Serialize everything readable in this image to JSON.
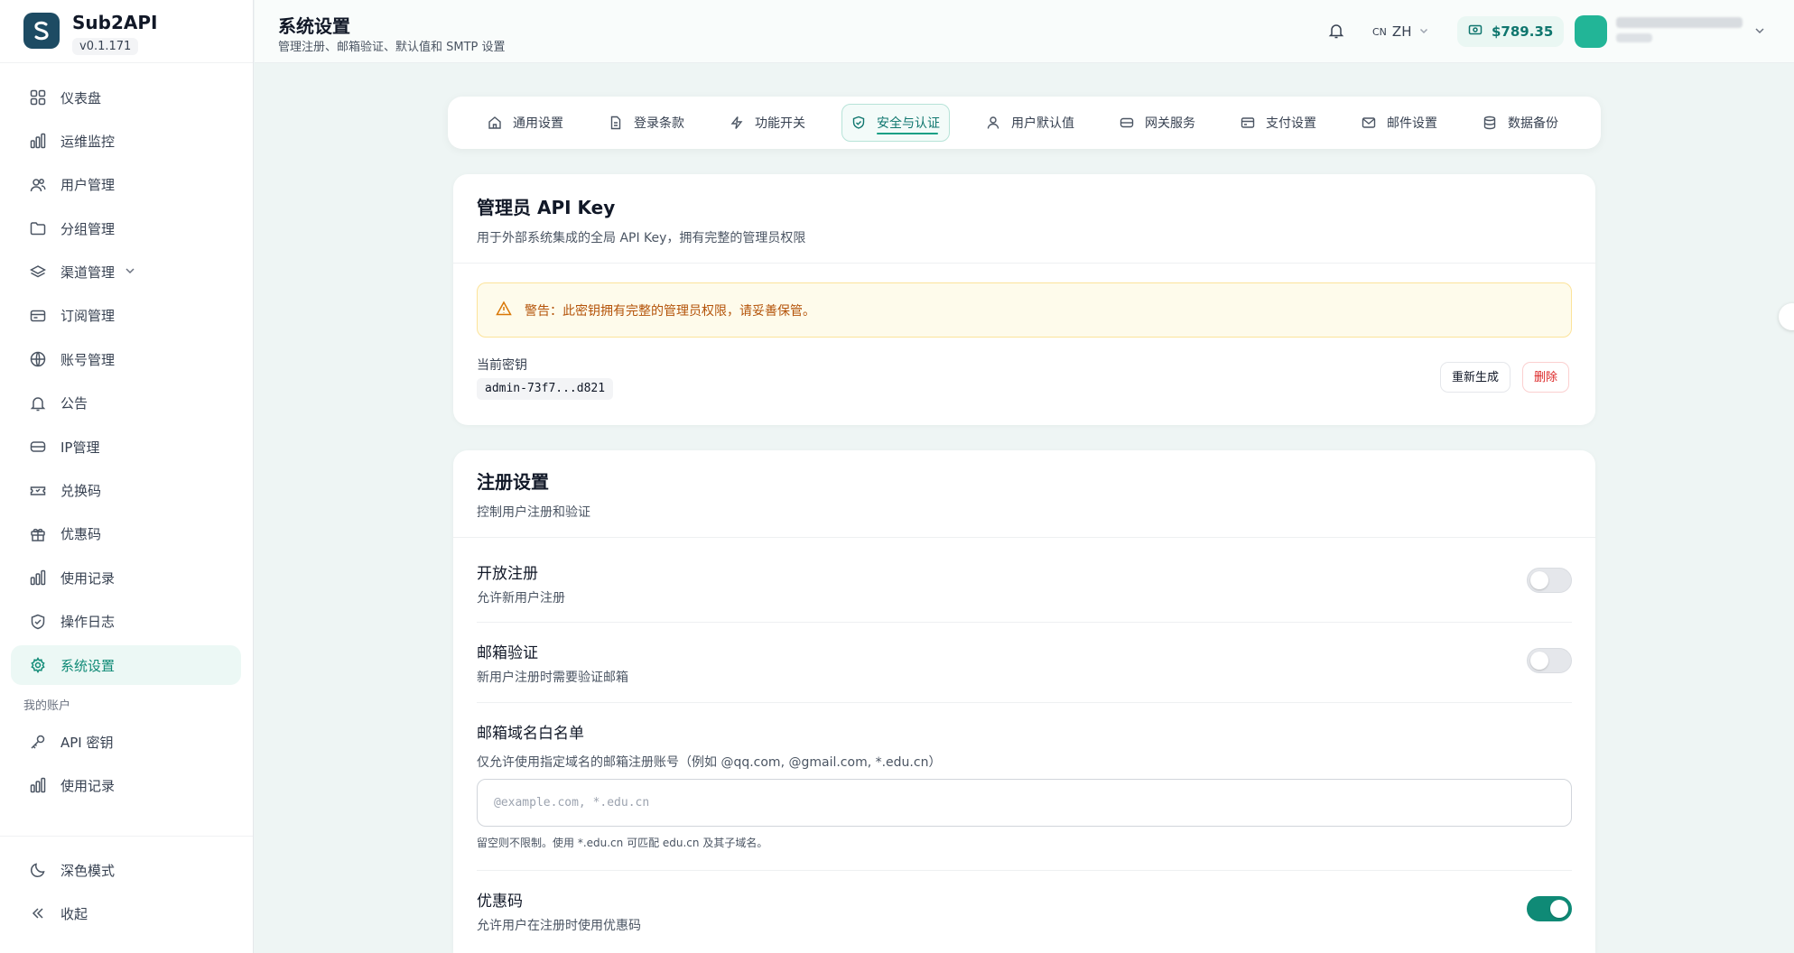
{
  "app": {
    "name": "Sub2API",
    "version": "v0.1.171"
  },
  "sidebar": {
    "items": [
      {
        "label": "仪表盘",
        "icon": "grid-icon"
      },
      {
        "label": "运维监控",
        "icon": "bar-chart-icon"
      },
      {
        "label": "用户管理",
        "icon": "users-icon"
      },
      {
        "label": "分组管理",
        "icon": "folder-icon"
      },
      {
        "label": "渠道管理",
        "icon": "layers-icon"
      },
      {
        "label": "订阅管理",
        "icon": "card-icon"
      },
      {
        "label": "账号管理",
        "icon": "globe-icon"
      },
      {
        "label": "公告",
        "icon": "bell-icon"
      },
      {
        "label": "IP管理",
        "icon": "server-icon"
      },
      {
        "label": "兑换码",
        "icon": "ticket-icon"
      },
      {
        "label": "优惠码",
        "icon": "gift-icon"
      },
      {
        "label": "使用记录",
        "icon": "bar-chart-icon"
      },
      {
        "label": "操作日志",
        "icon": "shield-icon"
      },
      {
        "label": "系统设置",
        "icon": "gear-icon"
      }
    ],
    "section_title": "我的账户",
    "account_items": [
      {
        "label": "API 密钥",
        "icon": "key-icon"
      },
      {
        "label": "使用记录",
        "icon": "bar-chart-icon"
      }
    ],
    "dark_mode_label": "深色模式",
    "collapse_label": "收起"
  },
  "header": {
    "title": "系统设置",
    "subtitle": "管理注册、邮箱验证、默认值和 SMTP 设置",
    "lang_flag": "CN",
    "lang_code": "ZH",
    "balance": "$789.35"
  },
  "tabs": [
    {
      "label": "通用设置"
    },
    {
      "label": "登录条款"
    },
    {
      "label": "功能开关"
    },
    {
      "label": "安全与认证"
    },
    {
      "label": "用户默认值"
    },
    {
      "label": "网关服务"
    },
    {
      "label": "支付设置"
    },
    {
      "label": "邮件设置"
    },
    {
      "label": "数据备份"
    }
  ],
  "admin_key": {
    "title": "管理员 API Key",
    "description": "用于外部系统集成的全局 API Key，拥有完整的管理员权限",
    "warning": "警告：此密钥拥有完整的管理员权限，请妥善保管。",
    "current_label": "当前密钥",
    "current_value": "admin-73f7...d821",
    "regenerate_label": "重新生成",
    "delete_label": "删除"
  },
  "registration": {
    "title": "注册设置",
    "description": "控制用户注册和验证",
    "open_title": "开放注册",
    "open_desc": "允许新用户注册",
    "open_enabled": false,
    "email_title": "邮箱验证",
    "email_desc": "新用户注册时需要验证邮箱",
    "email_enabled": false,
    "whitelist_title": "邮箱域名白名单",
    "whitelist_desc": "仅允许使用指定域名的邮箱注册账号（例如 @qq.com, @gmail.com, *.edu.cn）",
    "whitelist_placeholder": "@example.com, *.edu.cn",
    "whitelist_hint": "留空则不限制。使用 *.edu.cn 可匹配 edu.cn 及其子域名。",
    "promo_title": "优惠码",
    "promo_desc": "允许用户在注册时使用优惠码",
    "promo_enabled": true
  },
  "colors": {
    "accent": "#0f8a76",
    "warning": "#b45309"
  }
}
